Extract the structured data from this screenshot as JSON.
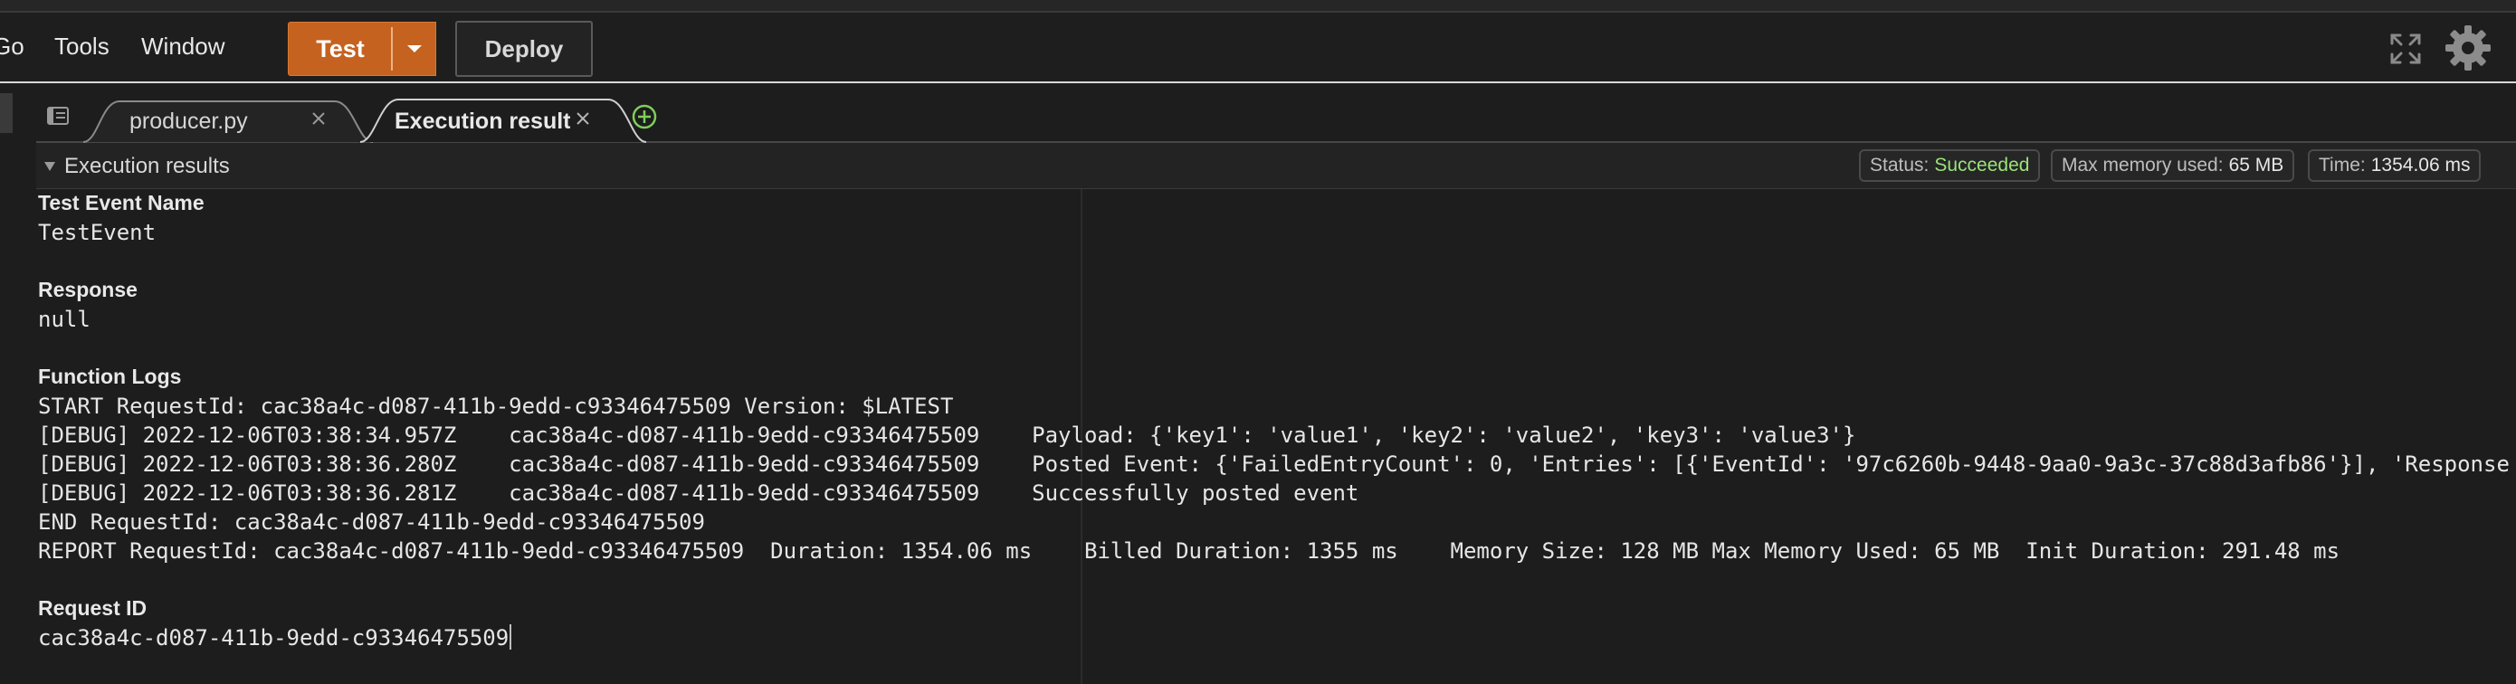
{
  "menu": {
    "go": "Go",
    "tools": "Tools",
    "window": "Window"
  },
  "toolbar": {
    "test_label": "Test",
    "deploy_label": "Deploy"
  },
  "tabs": [
    {
      "label": "producer.py"
    },
    {
      "label": "Execution results"
    }
  ],
  "results": {
    "title": "Execution results",
    "status_label": "Status:",
    "status_value": "Succeeded",
    "memory_label": "Max memory used:",
    "memory_value": "65 MB",
    "time_label": "Time:",
    "time_value": "1354.06 ms",
    "test_event_name_label": "Test Event Name",
    "test_event_name": "TestEvent",
    "response_label": "Response",
    "response": "null",
    "function_logs_label": "Function Logs",
    "logs": [
      "START RequestId: cac38a4c-d087-411b-9edd-c93346475509 Version: $LATEST",
      "[DEBUG] 2022-12-06T03:38:34.957Z    cac38a4c-d087-411b-9edd-c93346475509    Payload: {'key1': 'value1', 'key2': 'value2', 'key3': 'value3'}",
      "[DEBUG] 2022-12-06T03:38:36.280Z    cac38a4c-d087-411b-9edd-c93346475509    Posted Event: {'FailedEntryCount': 0, 'Entries': [{'EventId': '97c6260b-9448-9aa0-9a3c-37c88d3afb86'}], 'Response",
      "[DEBUG] 2022-12-06T03:38:36.281Z    cac38a4c-d087-411b-9edd-c93346475509    Successfully posted event",
      "END RequestId: cac38a4c-d087-411b-9edd-c93346475509",
      "REPORT RequestId: cac38a4c-d087-411b-9edd-c93346475509  Duration: 1354.06 ms    Billed Duration: 1355 ms    Memory Size: 128 MB Max Memory Used: 65 MB  Init Duration: 291.48 ms"
    ],
    "request_id_label": "Request ID",
    "request_id": "cac38a4c-d087-411b-9edd-c93346475509"
  },
  "icons": {
    "fullscreen": "fullscreen-icon",
    "settings": "gear-icon",
    "tab_menu": "tab-menu-icon",
    "close": "close-icon",
    "add_tab": "add-tab-icon",
    "dropdown": "chevron-down-icon",
    "collapse": "caret-down-icon"
  },
  "colors": {
    "accent": "#c5621f",
    "success": "#9be27a",
    "background": "#1d1d1d"
  }
}
